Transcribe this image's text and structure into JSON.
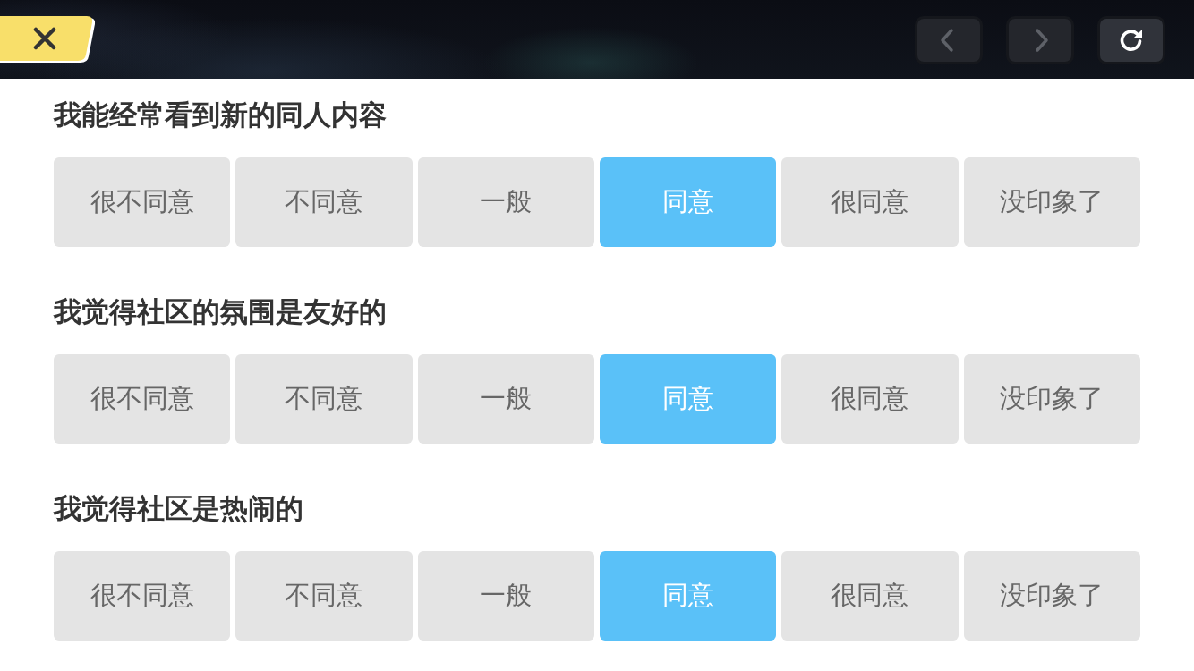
{
  "top_bar": {
    "nav_buttons": [
      {
        "kind": "back",
        "disabled": true
      },
      {
        "kind": "forward",
        "disabled": true
      },
      {
        "kind": "refresh",
        "disabled": false
      }
    ]
  },
  "questions": [
    {
      "title": "我能经常看到新的同人内容",
      "options": [
        {
          "label": "很不同意",
          "selected": false
        },
        {
          "label": "不同意",
          "selected": false
        },
        {
          "label": "一般",
          "selected": false
        },
        {
          "label": "同意",
          "selected": true
        },
        {
          "label": "很同意",
          "selected": false
        },
        {
          "label": "没印象了",
          "selected": false
        }
      ]
    },
    {
      "title": "我觉得社区的氛围是友好的",
      "options": [
        {
          "label": "很不同意",
          "selected": false
        },
        {
          "label": "不同意",
          "selected": false
        },
        {
          "label": "一般",
          "selected": false
        },
        {
          "label": "同意",
          "selected": true
        },
        {
          "label": "很同意",
          "selected": false
        },
        {
          "label": "没印象了",
          "selected": false
        }
      ]
    },
    {
      "title": "我觉得社区是热闹的",
      "options": [
        {
          "label": "很不同意",
          "selected": false
        },
        {
          "label": "不同意",
          "selected": false
        },
        {
          "label": "一般",
          "selected": false
        },
        {
          "label": "同意",
          "selected": true
        },
        {
          "label": "很同意",
          "selected": false
        },
        {
          "label": "没印象了",
          "selected": false
        }
      ]
    }
  ]
}
